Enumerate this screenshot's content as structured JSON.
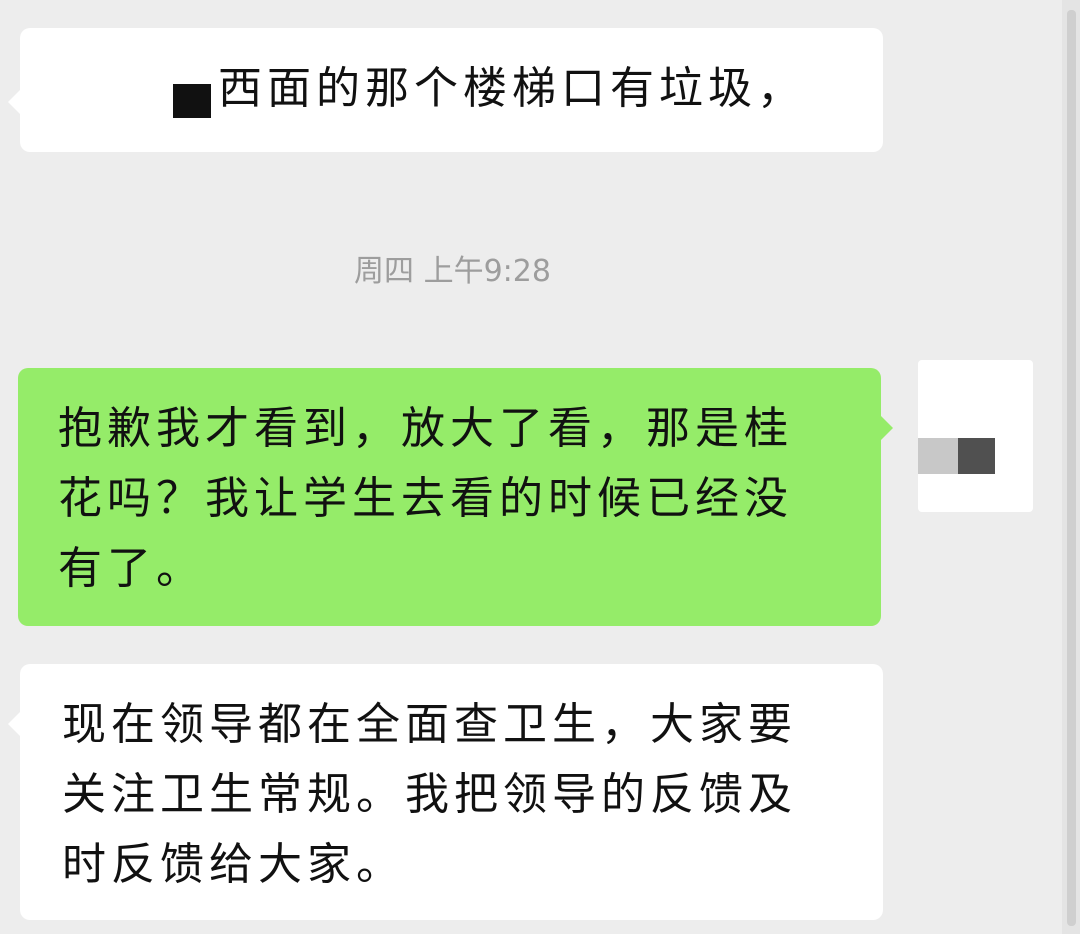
{
  "messages": [
    {
      "sender": "other",
      "text": "西面的那个楼梯口有垃圾，"
    },
    {
      "sender": "self",
      "lines": [
        "抱歉我才看到，放大了看，那是桂",
        "花吗？我让学生去看的时候已经没",
        "有了。"
      ]
    },
    {
      "sender": "other",
      "lines": [
        "现在领导都在全面查卫生，大家要",
        "关注卫生常规。我把领导的反馈及",
        "时反馈给大家。"
      ]
    }
  ],
  "timestamp": "周四 上午9:28",
  "colors": {
    "background": "#ededed",
    "incoming_bubble": "#ffffff",
    "outgoing_bubble": "#95ec69",
    "timestamp_text": "#9d9d9d"
  }
}
